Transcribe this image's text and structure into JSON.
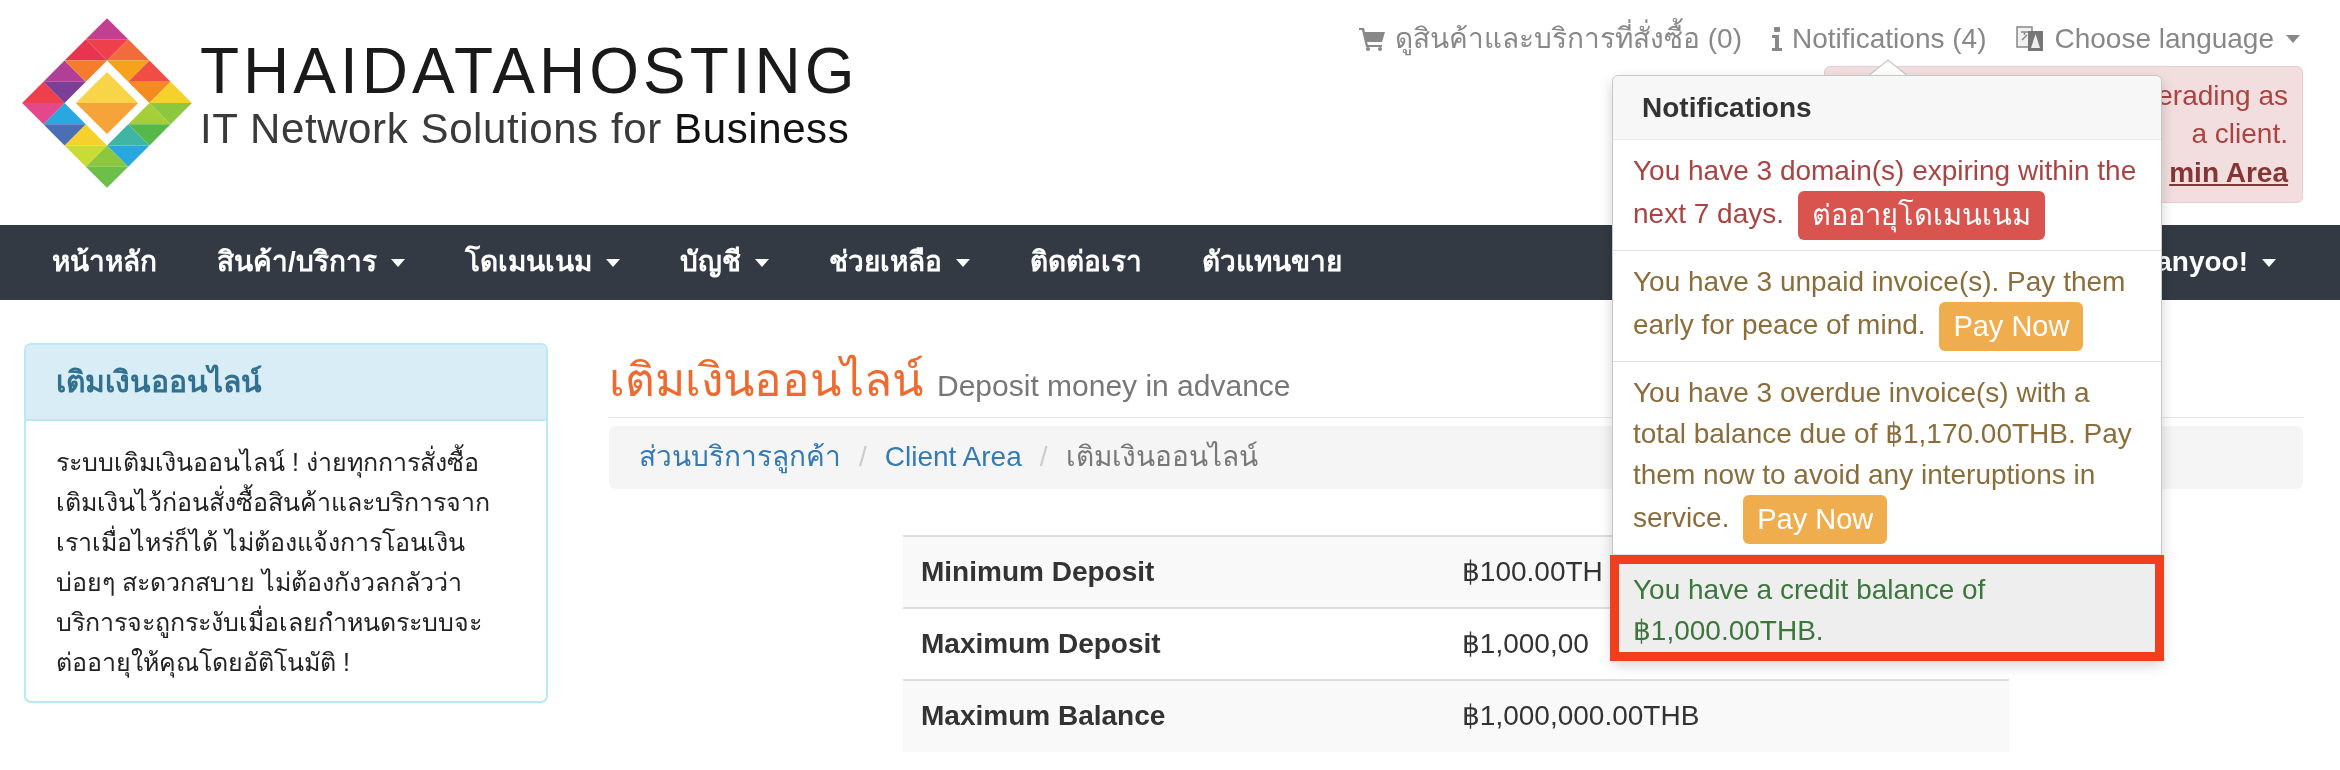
{
  "logo": {
    "name": "THAIDATAHOSTING",
    "tagline": "IT Network Solutions for **Business**"
  },
  "top_links": [
    {
      "kind": "cart",
      "label": "ดูสินค้าและบริการที่สั่งซื้อ (0)",
      "dropdown": false
    },
    {
      "kind": "notifications",
      "label": "Notifications (4)",
      "dropdown": false
    },
    {
      "kind": "language",
      "label": "Choose language",
      "dropdown": true
    }
  ],
  "admin_alert": {
    "text": "erading as a client.",
    "link": "min Area"
  },
  "nav": {
    "items": [
      {
        "label": "หน้าหลัก",
        "dropdown": false
      },
      {
        "label": "สินค้า/บริการ",
        "dropdown": true
      },
      {
        "label": "โดเมนเนม",
        "dropdown": true
      },
      {
        "label": "บัญชี",
        "dropdown": true
      },
      {
        "label": "ช่วยเหลือ",
        "dropdown": true
      },
      {
        "label": "ติดต่อเรา",
        "dropdown": false
      },
      {
        "label": "ตัวแทนขาย",
        "dropdown": false
      }
    ],
    "user_menu": {
      "label": "anyoo!",
      "dropdown": true
    }
  },
  "sidebar": {
    "title": "เติมเงินออนไลน์",
    "text": "ระบบเติมเงินออนไลน์ ! ง่ายทุกการสั่งซื้อเติมเงินไว้ก่อนสั่งซื้อสินค้าและบริการจากเราเมื่อไหร่ก็ได้ ไม่ต้องแจ้งการโอนเงินบ่อยๆ สะดวกสบาย ไม่ต้องกังวลกลัวว่าบริการจะถูกระงับเมื่อเลยกำหนดระบบจะต่ออายุให้คุณโดยอัติโนมัติ !"
  },
  "page": {
    "title": "เติมเงินออนไลน์",
    "subtitle": "Deposit money in advance"
  },
  "breadcrumb": [
    {
      "kind": "link",
      "label": "ส่วนบริการลูกค้า"
    },
    {
      "kind": "separator",
      "label": "/"
    },
    {
      "kind": "link",
      "label": "Client Area"
    },
    {
      "kind": "separator",
      "label": "/"
    },
    {
      "kind": "current",
      "label": "เติมเงินออนไลน์"
    }
  ],
  "limits": {
    "rows": [
      {
        "label": "Minimum Deposit",
        "value": "฿100.00TH"
      },
      {
        "label": "Maximum Deposit",
        "value": "฿1,000,00"
      },
      {
        "label": "Maximum Balance",
        "value": "฿1,000,000.00THB"
      }
    ]
  },
  "notifications": {
    "title": "Notifications",
    "items": [
      {
        "kind": "danger",
        "text": "You have 3 domain(s) expiring within the next 7 days.",
        "button": "ต่ออายุโดเมนเนม",
        "highlighted": false
      },
      {
        "kind": "warning",
        "text": "You have 3 unpaid invoice(s). Pay them early for peace of mind.",
        "button": "Pay Now",
        "highlighted": false
      },
      {
        "kind": "warning",
        "text": "You have 3 overdue invoice(s) with a total balance due of ฿1,170.00THB. Pay them now to avoid any interuptions in service.",
        "button": "Pay Now",
        "highlighted": false
      },
      {
        "kind": "success",
        "text": "You have a credit balance of ฿1,000.00THB.",
        "highlighted": true
      }
    ]
  }
}
